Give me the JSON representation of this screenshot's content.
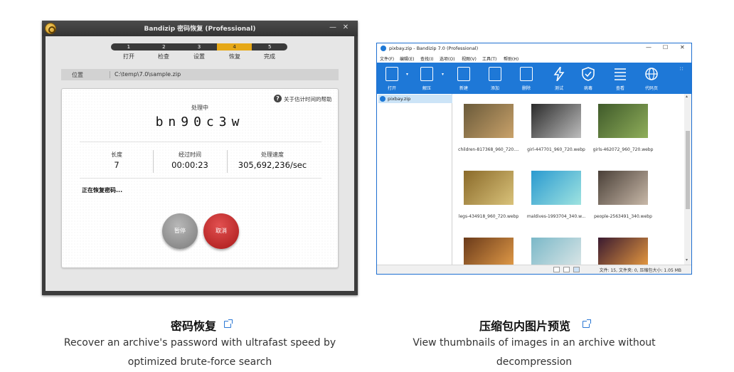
{
  "recovery_window": {
    "title": "Bandizip 密码恢复 (Professional)",
    "steps": [
      {
        "number": "1",
        "label": "打开"
      },
      {
        "number": "2",
        "label": "检查"
      },
      {
        "number": "3",
        "label": "设置"
      },
      {
        "number": "4",
        "label": "恢复"
      },
      {
        "number": "5",
        "label": "完成"
      }
    ],
    "active_step": 4,
    "location_label": "位置",
    "location_value": "C:\\temp\\7.0\\sample.zip",
    "help_text": "关于估计时间的帮助",
    "status_title": "处理中",
    "current_password": "bn90c3w",
    "stats": [
      {
        "label": "长度",
        "value": "7"
      },
      {
        "label": "经过时间",
        "value": "00:00:23"
      },
      {
        "label": "处理速度",
        "value": "305,692,236/sec"
      }
    ],
    "recovering_text": "正在恢复密码...",
    "pause_label": "暂停",
    "cancel_label": "取消"
  },
  "bandizip_window": {
    "title": "pixbay.zip - Bandizip 7.0 (Professional)",
    "menu": [
      "文件(F)",
      "编辑(E)",
      "查找(I)",
      "选项(O)",
      "视图(V)",
      "工具(T)",
      "帮助(H)"
    ],
    "toolbar": [
      "打开",
      "解压",
      "新建",
      "添加",
      "删除",
      "测试",
      "病毒",
      "查看",
      "代码页"
    ],
    "tree_item": "pixbay.zip",
    "files": [
      {
        "name": "children-817368_960_720....",
        "colors": [
          "#6a5a3a",
          "#c9a26a"
        ]
      },
      {
        "name": "girl-447701_960_720.webp",
        "colors": [
          "#2a2a2a",
          "#bdbdbd"
        ]
      },
      {
        "name": "girls-462072_960_720.webp",
        "colors": [
          "#3f5a2a",
          "#8fae5a"
        ]
      },
      {
        "name": "legs-434918_960_720.webp",
        "colors": [
          "#8a6a2a",
          "#d9c27a"
        ]
      },
      {
        "name": "maldives-1993704_340.w...",
        "colors": [
          "#2a9ad0",
          "#9fe3e0"
        ]
      },
      {
        "name": "people-2563491_340.webp",
        "colors": [
          "#4a4038",
          "#c8b8a8"
        ]
      },
      {
        "name": "",
        "colors": [
          "#6a3a1a",
          "#e8a04a"
        ]
      },
      {
        "name": "",
        "colors": [
          "#7ab8c8",
          "#e0e8e8"
        ]
      },
      {
        "name": "",
        "colors": [
          "#3a1a30",
          "#f0a040"
        ]
      }
    ],
    "status_text": "文件: 15, 文件夹: 0, 压缩包大小: 1.05 MB"
  },
  "captions": [
    {
      "title": "密码恢复",
      "description": "Recover an archive's password with ultrafast speed by optimized brute-force search"
    },
    {
      "title": "压缩包内图片预览",
      "description": "View thumbnails of images in an archive without decompression"
    }
  ]
}
